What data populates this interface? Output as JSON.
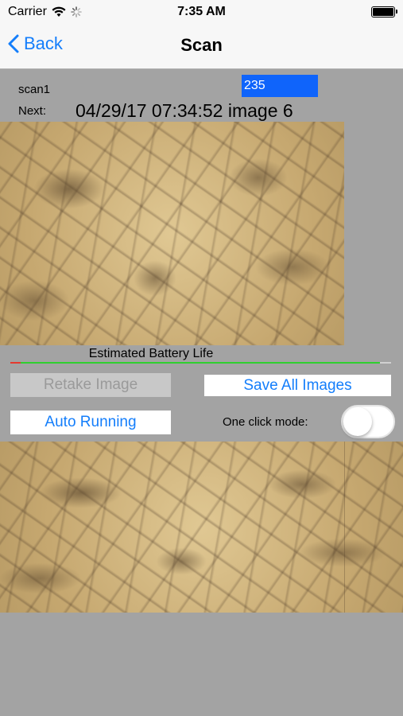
{
  "status_bar": {
    "carrier": "Carrier",
    "time": "7:35 AM"
  },
  "nav": {
    "back_label": "Back",
    "title": "Scan"
  },
  "scan": {
    "name": "scan1",
    "count": "235",
    "next_label": "Next:",
    "next_value": "04/29/17 07:34:52 image 6"
  },
  "battery": {
    "label": "Estimated Battery Life",
    "level": 0.97,
    "level_color": "#2fcf2f",
    "low_color": "#e53a2e"
  },
  "buttons": {
    "retake": "Retake Image",
    "save_all": "Save All Images",
    "auto_running": "Auto Running"
  },
  "one_click": {
    "label": "One click mode:",
    "enabled": false
  },
  "colors": {
    "accent": "#147efb",
    "field_bg": "#0f64fb",
    "background": "#a3a3a3"
  },
  "icons": [
    "wifi-icon",
    "activity-spinner-icon",
    "battery-icon",
    "chevron-left-icon"
  ]
}
